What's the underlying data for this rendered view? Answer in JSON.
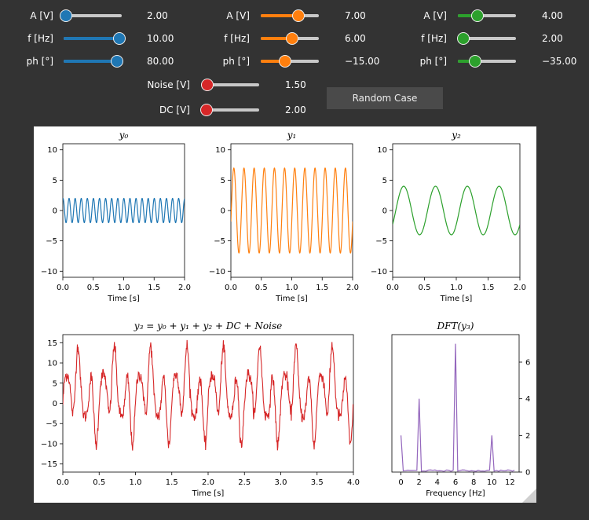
{
  "controls": {
    "groups": [
      {
        "color": "#1f77b4",
        "sliders": [
          {
            "label": "A [V]",
            "value": "2.00",
            "fraction": 0.05
          },
          {
            "label": "f [Hz]",
            "value": "10.00",
            "fraction": 0.97
          },
          {
            "label": "ph [°]",
            "value": "80.00",
            "fraction": 0.93
          }
        ]
      },
      {
        "color": "#ff7f0e",
        "sliders": [
          {
            "label": "A [V]",
            "value": "7.00",
            "fraction": 0.66
          },
          {
            "label": "f [Hz]",
            "value": "6.00",
            "fraction": 0.55
          },
          {
            "label": "ph [°]",
            "value": "−15.00",
            "fraction": 0.42
          }
        ]
      },
      {
        "color": "#2ca02c",
        "sliders": [
          {
            "label": "A [V]",
            "value": "4.00",
            "fraction": 0.35
          },
          {
            "label": "f [Hz]",
            "value": "2.00",
            "fraction": 0.1
          },
          {
            "label": "ph [°]",
            "value": "−35.00",
            "fraction": 0.3
          }
        ]
      }
    ],
    "noise": {
      "label": "Noise [V]",
      "value": "1.50",
      "fraction": 0.12,
      "color": "#d62728"
    },
    "dc": {
      "label": "DC [V]",
      "value": "2.00",
      "fraction": 0.1,
      "color": "#d62728"
    },
    "random_button": "Random Case"
  },
  "chart_data": [
    {
      "type": "line",
      "title": "y₀",
      "xlabel": "Time [s]",
      "xlim": [
        0,
        2
      ],
      "ylim": [
        -11,
        11
      ],
      "xticks": [
        "0.0",
        "0.5",
        "1.0",
        "1.5",
        "2.0"
      ],
      "yticks": [
        "10",
        "5",
        "0",
        "−5",
        "−10"
      ],
      "series": [
        {
          "color": "#1f77b4",
          "amplitude": 2,
          "frequency": 10,
          "phase_deg": 80
        }
      ]
    },
    {
      "type": "line",
      "title": "y₁",
      "xlabel": "Time [s]",
      "xlim": [
        0,
        2
      ],
      "ylim": [
        -11,
        11
      ],
      "xticks": [
        "0.0",
        "0.5",
        "1.0",
        "1.5",
        "2.0"
      ],
      "yticks": [
        "10",
        "5",
        "0",
        "−5",
        "−10"
      ],
      "series": [
        {
          "color": "#ff7f0e",
          "amplitude": 7,
          "frequency": 6,
          "phase_deg": -15
        }
      ]
    },
    {
      "type": "line",
      "title": "y₂",
      "xlabel": "Time [s]",
      "xlim": [
        0,
        2
      ],
      "ylim": [
        -11,
        11
      ],
      "xticks": [
        "0.0",
        "0.5",
        "1.0",
        "1.5",
        "2.0"
      ],
      "yticks": [
        "10",
        "5",
        "0",
        "−5",
        "−10"
      ],
      "series": [
        {
          "color": "#2ca02c",
          "amplitude": 4,
          "frequency": 2,
          "phase_deg": -35
        }
      ]
    },
    {
      "type": "line",
      "title": "y₃ = y₀ + y₁ + y₂ + DC + Noise",
      "xlabel": "Time [s]",
      "xlim": [
        0,
        4
      ],
      "ylim": [
        -17,
        17
      ],
      "xticks": [
        "0.0",
        "0.5",
        "1.0",
        "1.5",
        "2.0",
        "2.5",
        "3.0",
        "3.5",
        "4.0"
      ],
      "yticks": [
        "15",
        "10",
        "5",
        "0",
        "−5",
        "−10",
        "−15"
      ],
      "series": [
        {
          "color": "#d62728",
          "dc": 2,
          "noise": 1.5
        }
      ]
    },
    {
      "type": "line",
      "title": "DFT(y₃)",
      "xlabel": "Frequency [Hz]",
      "xlim": [
        -1,
        13
      ],
      "ylim": [
        0,
        7.5
      ],
      "xticks": [
        "0",
        "2",
        "4",
        "6",
        "8",
        "10",
        "12"
      ],
      "yticks": [
        "6",
        "4",
        "2",
        "0"
      ],
      "series": [
        {
          "color": "#9467bd",
          "x": [
            0,
            2,
            6,
            10
          ],
          "y": [
            2,
            4,
            7,
            2
          ]
        }
      ]
    }
  ]
}
